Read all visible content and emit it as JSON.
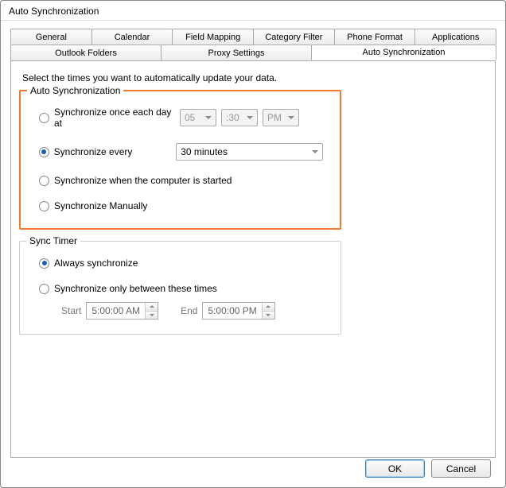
{
  "window": {
    "title": "Auto Synchronization"
  },
  "tabs_row1": {
    "general": "General",
    "calendar": "Calendar",
    "field_mapping": "Field Mapping",
    "category_filter": "Category Filter",
    "phone_format": "Phone Format",
    "applications": "Applications"
  },
  "tabs_row2": {
    "outlook_folders": "Outlook Folders",
    "proxy_settings": "Proxy Settings",
    "auto_sync": "Auto Synchronization"
  },
  "intro": "Select the times you want to automatically update your data.",
  "auto_sync_group": {
    "legend": "Auto Synchronization",
    "opt_daily": "Synchronize once each day at",
    "daily_hour": "05",
    "daily_minute": ":30",
    "daily_ampm": "PM",
    "opt_every": "Synchronize every",
    "every_value": "30 minutes",
    "opt_startup": "Synchronize when the computer is started",
    "opt_manual": "Synchronize Manually",
    "selected": "every"
  },
  "sync_timer_group": {
    "legend": "Sync Timer",
    "opt_always": "Always synchronize",
    "opt_between": "Synchronize only between these times",
    "start_label": "Start",
    "start_value": "5:00:00 AM",
    "end_label": "End",
    "end_value": "5:00:00 PM",
    "selected": "always"
  },
  "buttons": {
    "ok": "OK",
    "cancel": "Cancel"
  }
}
